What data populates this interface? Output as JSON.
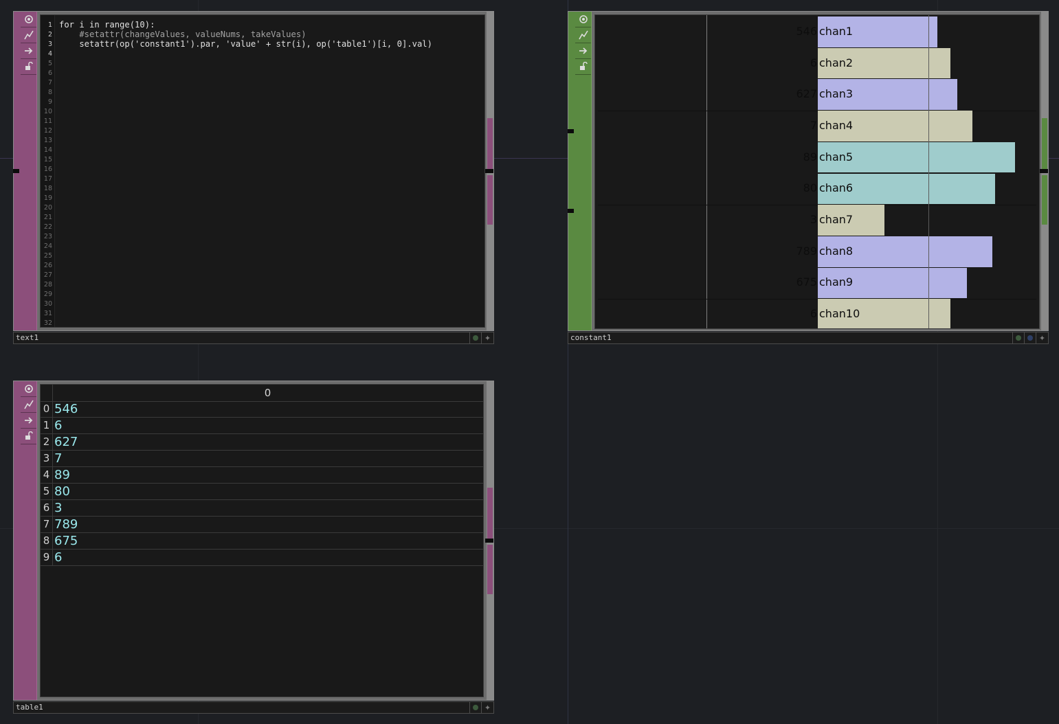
{
  "text1": {
    "name": "text1",
    "line_numbers": [
      "1",
      "2",
      "3",
      "4",
      "5",
      "6",
      "7",
      "8",
      "9",
      "10",
      "11",
      "12",
      "13",
      "14",
      "15",
      "16",
      "17",
      "18",
      "19",
      "20",
      "21",
      "22",
      "23",
      "24",
      "25",
      "26",
      "27",
      "28",
      "29",
      "30",
      "31",
      "32"
    ],
    "code": [
      {
        "text": "for i in range(10):",
        "comment": false
      },
      {
        "text": "    #setattr(changeValues, valueNums, takeValues)",
        "comment": true
      },
      {
        "text": "    setattr(op('constant1').par, 'value' + str(i), op('table1')[i, 0].val)",
        "comment": false
      }
    ]
  },
  "table1": {
    "name": "table1",
    "header": "0",
    "rows": [
      {
        "index": "0",
        "value": "546"
      },
      {
        "index": "1",
        "value": "6"
      },
      {
        "index": "2",
        "value": "627"
      },
      {
        "index": "3",
        "value": "7"
      },
      {
        "index": "4",
        "value": "89"
      },
      {
        "index": "5",
        "value": "80"
      },
      {
        "index": "6",
        "value": "3"
      },
      {
        "index": "7",
        "value": "789"
      },
      {
        "index": "8",
        "value": "675"
      },
      {
        "index": "9",
        "value": "6"
      }
    ]
  },
  "constant1": {
    "name": "constant1",
    "channels": [
      {
        "name": "chan1",
        "value": "546",
        "fill": 0.54,
        "color": "#b3b3e6"
      },
      {
        "name": "chan2",
        "value": "6",
        "fill": 0.6,
        "color": "#cbcbb2"
      },
      {
        "name": "chan3",
        "value": "627",
        "fill": 0.63,
        "color": "#b3b3e6"
      },
      {
        "name": "chan4",
        "value": "7",
        "fill": 0.7,
        "color": "#cbcbb2"
      },
      {
        "name": "chan5",
        "value": "89",
        "fill": 0.89,
        "color": "#9fcccc"
      },
      {
        "name": "chan6",
        "value": "80",
        "fill": 0.8,
        "color": "#9fcccc"
      },
      {
        "name": "chan7",
        "value": "3",
        "fill": 0.3,
        "color": "#cbcbb2"
      },
      {
        "name": "chan8",
        "value": "789",
        "fill": 0.79,
        "color": "#b3b3e6"
      },
      {
        "name": "chan9",
        "value": "675",
        "fill": 0.675,
        "color": "#b3b3e6"
      },
      {
        "name": "chan10",
        "value": "6",
        "fill": 0.6,
        "color": "#cbcbb2"
      }
    ]
  },
  "icons": [
    "viewer-active-icon",
    "cook-icon",
    "bypass-arrow-icon",
    "lock-icon",
    "display-flag-icon",
    "render-flag-icon",
    "pin-icon"
  ],
  "colors": {
    "dat": "#8c4f7b",
    "chop": "#5a8a41",
    "accent_cyan": "#9ae8ec"
  }
}
